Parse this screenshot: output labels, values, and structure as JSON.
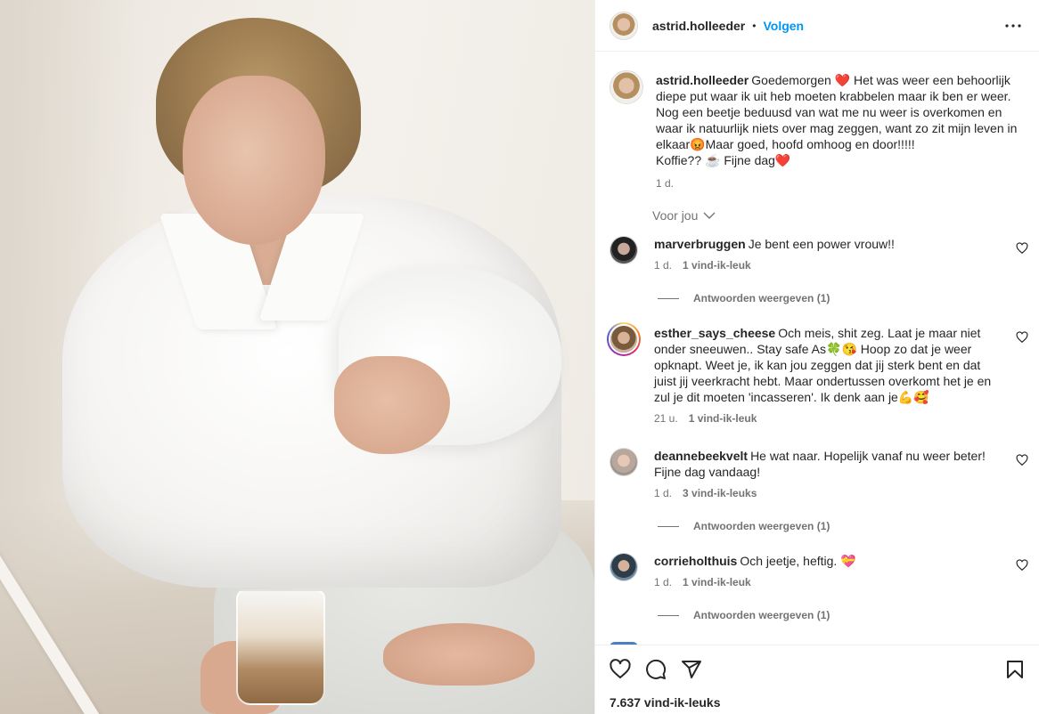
{
  "header": {
    "username": "astrid.holleeder",
    "separator": "•",
    "follow_label": "Volgen"
  },
  "caption": {
    "username": "astrid.holleeder",
    "text": "Goedemorgen ❤️ Het was weer een behoorlijk diepe put waar ik uit heb moeten krabbelen maar ik ben er weer. Nog een beetje beduusd van wat me nu weer is overkomen en waar ik natuurlijk niets over mag zeggen, want zo zit mijn leven in elkaar😡Maar goed, hoofd omhoog en door!!!!!",
    "text2": "Koffie?? ☕ Fijne dag❤️",
    "time": "1 d."
  },
  "voor_jou_label": "Voor jou",
  "comments": [
    {
      "username": "marverbruggen",
      "text": "Je bent een power vrouw!!",
      "time": "1 d.",
      "likes": "1 vind-ik-leuk",
      "replies": "Antwoorden weergeven (1)"
    },
    {
      "username": "esther_says_cheese",
      "text": "Och meis, shit zeg. Laat je maar niet onder sneeuwen.. Stay safe As🍀😘 Hoop zo dat je weer opknapt. Weet je, ik kan jou zeggen dat jij sterk bent en dat juist jij veerkracht hebt. Maar ondertussen overkomt het je en zul je dit moeten 'incasseren'. Ik denk aan je💪🥰",
      "time": "21 u.",
      "likes": "1 vind-ik-leuk"
    },
    {
      "username": "deannebeekvelt",
      "text": "He wat naar. Hopelijk vanaf nu weer beter! Fijne dag vandaag!",
      "time": "1 d.",
      "likes": "3 vind-ik-leuks",
      "replies": "Antwoorden weergeven (1)"
    },
    {
      "username": "corrieholthuis",
      "text": "Och jeetje, heftig. 💝",
      "time": "1 d.",
      "likes": "1 vind-ik-leuk",
      "replies": "Antwoorden weergeven (1)"
    }
  ],
  "footer": {
    "likes_count": "7.637 vind-ik-leuks"
  },
  "colors": {
    "link_blue": "#0095f6",
    "text": "#262626",
    "muted": "#737373",
    "border": "#efefef"
  },
  "icons": [
    "more-horizontal-icon",
    "heart-icon",
    "comment-icon",
    "share-icon",
    "bookmark-icon",
    "chevron-down-icon"
  ]
}
